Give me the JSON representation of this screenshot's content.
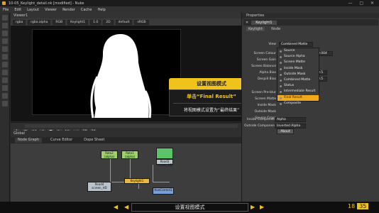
{
  "titlebar": {
    "title": "10-05_Keylight_detail.nk [modified] - Nuke"
  },
  "menu": [
    "File",
    "Edit",
    "Layout",
    "Viewer",
    "Render",
    "Cache",
    "Help"
  ],
  "viewer": {
    "tab": "Viewer1",
    "controls": [
      "rgba",
      "rgba.alpha",
      "RGB",
      "Keylight1",
      "1.0",
      "2D",
      "default",
      "sRGB"
    ],
    "info": "960x540 bbox: 0 0 960 540 chw: xx z=6 y=164"
  },
  "callout": {
    "title": "设置视图模式",
    "step": "单击“Final Result”",
    "desc": "将视图模式设置为“最终结果”"
  },
  "timeline": {
    "global_label": "Global",
    "frame": "1",
    "fps": "24",
    "end": "10"
  },
  "nodegraph": {
    "tabs": [
      "Node Graph",
      "Curve Editor",
      "Dope Sheet"
    ],
    "nodes": {
      "roto2": "Roto2\n(alpha)",
      "roto1": "Roto1\n(alpha)",
      "read4": "Read4\nscreen_HD",
      "keylight": "Keylight1",
      "huecorrect": "HueCorrect1",
      "read3": "Read3\nscreen_HD"
    }
  },
  "properties": {
    "tab": "Properties",
    "node_name": "Keylight1",
    "subtabs": [
      "Keylight",
      "Node"
    ],
    "rows": [
      {
        "label": "View",
        "value": "Combined Matte"
      },
      {
        "label": "Screen Colour",
        "value": "0.004"
      },
      {
        "label": "Screen Gain",
        "value": ""
      },
      {
        "label": "Screen Balance",
        "value": ""
      },
      {
        "label": "Alpha Bias",
        "value": "0.5"
      },
      {
        "label": "Despill Bias",
        "value": "0.5"
      },
      {
        "label": "Screen Pre-blur",
        "value": ""
      },
      {
        "label": "Screen Matte",
        "value": ""
      },
      {
        "label": "Inside Mask",
        "value": ""
      },
      {
        "label": "Outside Mask",
        "value": ""
      },
      {
        "label": "Source Crops",
        "value": ""
      }
    ],
    "components": [
      {
        "label": "Inside Component",
        "value": "Alpha"
      },
      {
        "label": "Outside Component",
        "value": "Inverted Alpha"
      }
    ],
    "view_options": [
      "Source",
      "Source Alpha",
      "Screen Matte",
      "Inside Mask",
      "Outside Mask",
      "Combined Matte",
      "Status",
      "Intermediate Result",
      "Final Result",
      "Composite"
    ],
    "selected_option": "Final Result",
    "about": "About"
  },
  "bottom": {
    "label": "设置视图模式",
    "page": "18",
    "total": "35"
  }
}
